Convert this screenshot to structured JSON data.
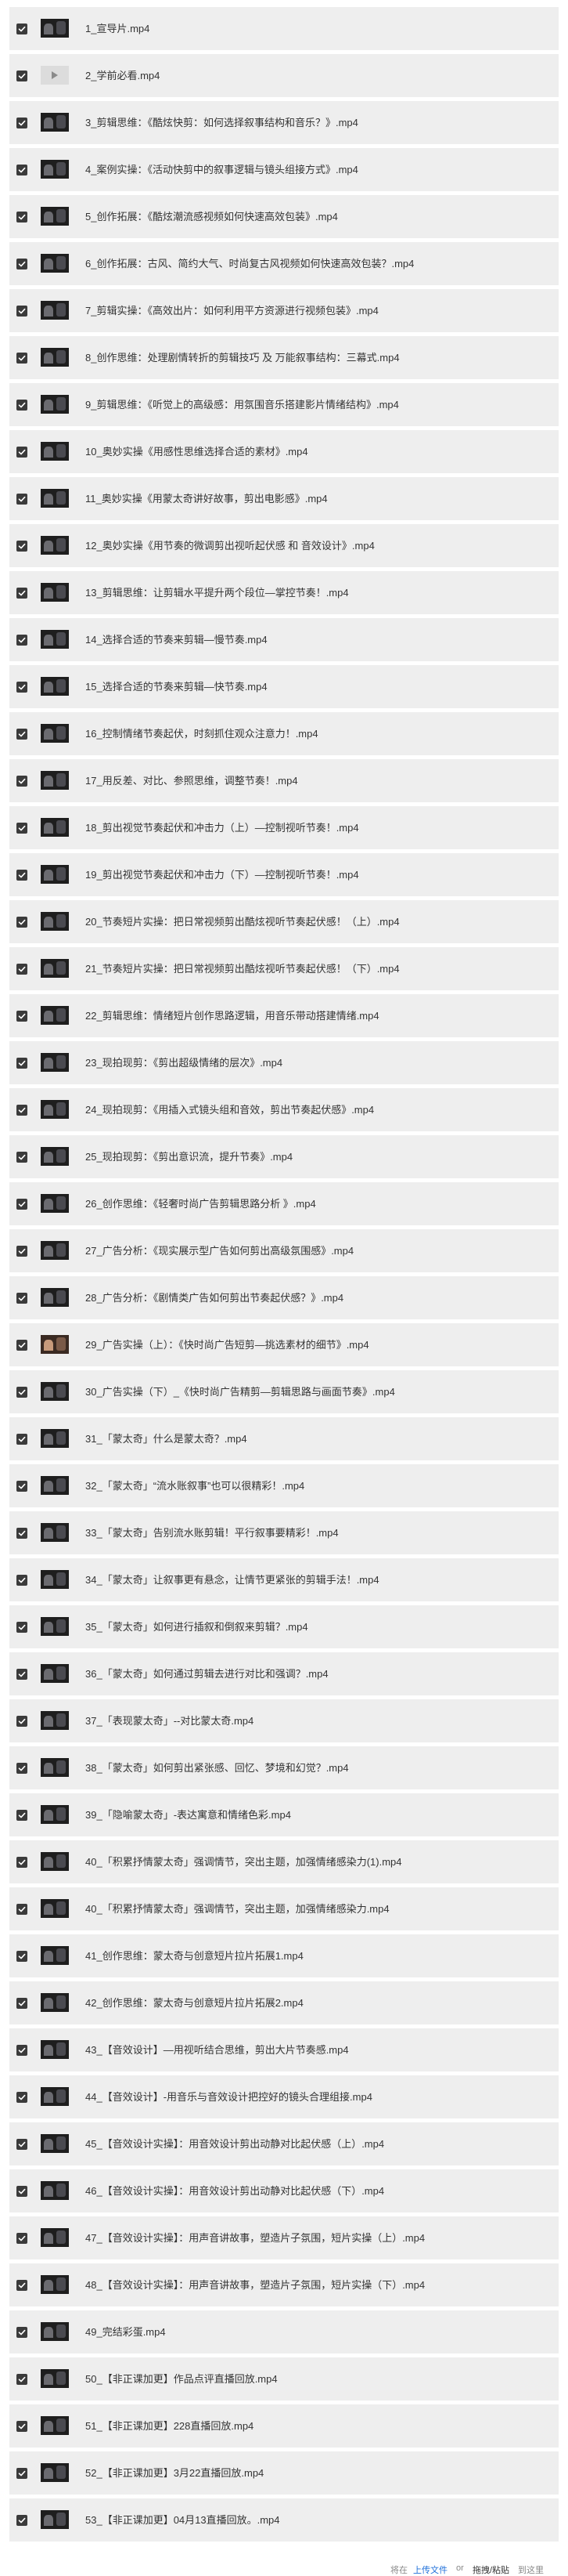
{
  "files": [
    {
      "name": "1_宣导片.mp4",
      "thumb": "dark"
    },
    {
      "name": "2_学前必看.mp4",
      "thumb": "light"
    },
    {
      "name": "3_剪辑思维：《酷炫快剪：如何选择叙事结构和音乐？》.mp4",
      "thumb": "dark"
    },
    {
      "name": "4_案例实操：《活动快剪中的叙事逻辑与镜头组接方式》.mp4",
      "thumb": "dark"
    },
    {
      "name": "5_创作拓展：《酷炫潮流感视频如何快速高效包装》.mp4",
      "thumb": "dark"
    },
    {
      "name": "6_创作拓展：古风、简约大气、时尚复古风视频如何快速高效包装？.mp4",
      "thumb": "dark"
    },
    {
      "name": "7_剪辑实操：《高效出片：如何利用平方资源进行视频包装》.mp4",
      "thumb": "dark"
    },
    {
      "name": "8_创作思维：处理剧情转折的剪辑技巧 及 万能叙事结构：三幕式.mp4",
      "thumb": "dark"
    },
    {
      "name": "9_剪辑思维：《听觉上的高级感：用氛围音乐搭建影片情绪结构》.mp4",
      "thumb": "dark"
    },
    {
      "name": "10_奥妙实操《用感性思维选择合适的素材》.mp4",
      "thumb": "dark"
    },
    {
      "name": "11_奥妙实操《用蒙太奇讲好故事，剪出电影感》.mp4",
      "thumb": "dark"
    },
    {
      "name": "12_奥妙实操《用节奏的微调剪出视听起伏感 和 音效设计》.mp4",
      "thumb": "dark"
    },
    {
      "name": "13_剪辑思维：让剪辑水平提升两个段位—掌控节奏！.mp4",
      "thumb": "dark"
    },
    {
      "name": "14_选择合适的节奏来剪辑—慢节奏.mp4",
      "thumb": "dark"
    },
    {
      "name": "15_选择合适的节奏来剪辑—快节奏.mp4",
      "thumb": "dark"
    },
    {
      "name": "16_控制情绪节奏起伏，时刻抓住观众注意力！.mp4",
      "thumb": "dark"
    },
    {
      "name": "17_用反差、对比、参照思维，调整节奏！.mp4",
      "thumb": "dark"
    },
    {
      "name": "18_剪出视觉节奏起伏和冲击力（上）—控制视听节奏！.mp4",
      "thumb": "dark"
    },
    {
      "name": "19_剪出视觉节奏起伏和冲击力（下）—控制视听节奏！.mp4",
      "thumb": "dark"
    },
    {
      "name": "20_节奏短片实操：把日常视频剪出酷炫视听节奏起伏感！（上）.mp4",
      "thumb": "dark"
    },
    {
      "name": "21_节奏短片实操：把日常视频剪出酷炫视听节奏起伏感！（下）.mp4",
      "thumb": "dark"
    },
    {
      "name": "22_剪辑思维：情绪短片创作思路逻辑，用音乐带动搭建情绪.mp4",
      "thumb": "dark"
    },
    {
      "name": "23_现拍现剪：《剪出超级情绪的层次》.mp4",
      "thumb": "dark"
    },
    {
      "name": "24_现拍现剪：《用插入式镜头组和音效，剪出节奏起伏感》.mp4",
      "thumb": "dark"
    },
    {
      "name": "25_现拍现剪：《剪出意识流，提升节奏》.mp4",
      "thumb": "dark"
    },
    {
      "name": "26_创作思维：《轻奢时尚广告剪辑思路分析 》.mp4",
      "thumb": "dark"
    },
    {
      "name": "27_广告分析：《现实展示型广告如何剪出高级氛围感》.mp4",
      "thumb": "dark"
    },
    {
      "name": "28_广告分析：《剧情类广告如何剪出节奏起伏感？》.mp4",
      "thumb": "dark"
    },
    {
      "name": "29_广告实操（上）：《快时尚广告短剪—挑选素材的细节》.mp4",
      "thumb": "warm"
    },
    {
      "name": "30_广告实操（下）_《快时尚广告精剪—剪辑思路与画面节奏》.mp4",
      "thumb": "dark"
    },
    {
      "name": "31_「蒙太奇」什么是蒙太奇？.mp4",
      "thumb": "dark"
    },
    {
      "name": "32_「蒙太奇」“流水账叙事”也可以很精彩！.mp4",
      "thumb": "dark"
    },
    {
      "name": "33_「蒙太奇」告别流水账剪辑！平行叙事要精彩！.mp4",
      "thumb": "dark"
    },
    {
      "name": "34_「蒙太奇」让叙事更有悬念，让情节更紧张的剪辑手法！.mp4",
      "thumb": "dark"
    },
    {
      "name": "35_「蒙太奇」如何进行插叙和倒叙来剪辑？.mp4",
      "thumb": "dark"
    },
    {
      "name": "36_「蒙太奇」如何通过剪辑去进行对比和强调？.mp4",
      "thumb": "dark"
    },
    {
      "name": "37_「表现蒙太奇」--对比蒙太奇.mp4",
      "thumb": "dark"
    },
    {
      "name": "38_「蒙太奇」如何剪出紧张感、回忆、梦境和幻觉？.mp4",
      "thumb": "dark"
    },
    {
      "name": "39_「隐喻蒙太奇」-表达寓意和情绪色彩.mp4",
      "thumb": "dark"
    },
    {
      "name": "40_「积累抒情蒙太奇」强调情节，突出主题，加强情绪感染力(1).mp4",
      "thumb": "dark"
    },
    {
      "name": "40_「积累抒情蒙太奇」强调情节，突出主题，加强情绪感染力.mp4",
      "thumb": "dark"
    },
    {
      "name": "41_创作思维：蒙太奇与创意短片拉片拓展1.mp4",
      "thumb": "dark"
    },
    {
      "name": "42_创作思维：蒙太奇与创意短片拉片拓展2.mp4",
      "thumb": "dark"
    },
    {
      "name": "43_【音效设计】—用视听结合思维，剪出大片节奏感.mp4",
      "thumb": "dark"
    },
    {
      "name": "44_【音效设计】-用音乐与音效设计把控好的镜头合理组接.mp4",
      "thumb": "dark"
    },
    {
      "name": "45_【音效设计实操】：用音效设计剪出动静对比起伏感（上）.mp4",
      "thumb": "dark"
    },
    {
      "name": "46_【音效设计实操】：用音效设计剪出动静对比起伏感（下）.mp4",
      "thumb": "dark"
    },
    {
      "name": "47_【音效设计实操】：用声音讲故事，塑造片子氛围，短片实操（上）.mp4",
      "thumb": "dark"
    },
    {
      "name": "48_【音效设计实操】：用声音讲故事，塑造片子氛围，短片实操（下）.mp4",
      "thumb": "dark"
    },
    {
      "name": "49_完结彩蛋.mp4",
      "thumb": "dark"
    },
    {
      "name": "50_【非正课加更】作品点评直播回放.mp4",
      "thumb": "dark"
    },
    {
      "name": "51_【非正课加更】228直播回放.mp4",
      "thumb": "dark"
    },
    {
      "name": "52_【非正课加更】3月22直播回放.mp4",
      "thumb": "dark"
    },
    {
      "name": "53_【非正课加更】04月13直播回放。.mp4",
      "thumb": "dark"
    }
  ],
  "footer": {
    "prefix": "将在",
    "upload_link": "上传文件",
    "or": "or",
    "drag_text": "拖拽/粘贴",
    "suffix": "到这里"
  }
}
